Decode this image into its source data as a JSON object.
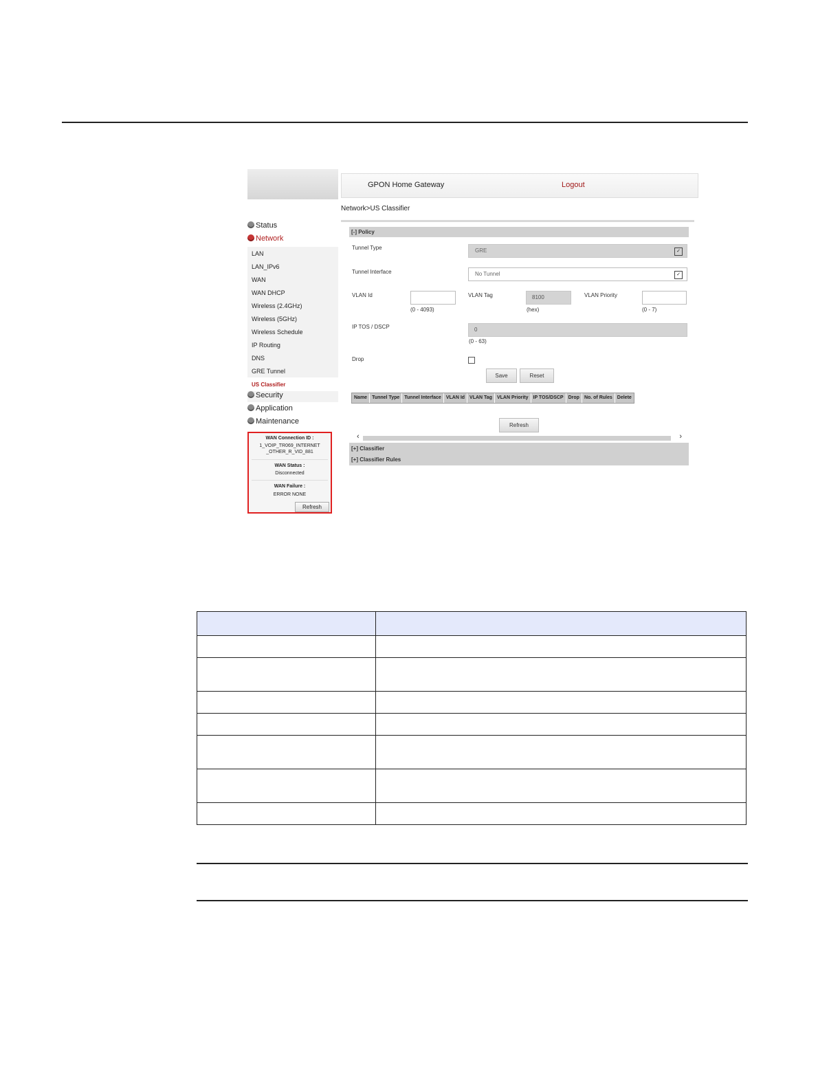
{
  "screenshot": {
    "header": {
      "title": "GPON Home Gateway",
      "logout": "Logout"
    },
    "breadcrumb": "Network>US Classifier",
    "sidebar": {
      "groups": [
        "Status",
        "Network",
        "Security",
        "Application",
        "Maintenance"
      ],
      "network_items": [
        "LAN",
        "LAN_IPv6",
        "WAN",
        "WAN DHCP",
        "Wireless (2.4GHz)",
        "Wireless (5GHz)",
        "Wireless Schedule",
        "IP Routing",
        "DNS",
        "GRE Tunnel",
        "US Classifier"
      ],
      "active_group": "Network",
      "selected_item": "US Classifier"
    },
    "wan_box": {
      "conn_label": "WAN Connection ID :",
      "conn_value": "1_VOIP_TR069_INTERNET _OTHER_R_VID_881",
      "status_label": "WAN Status :",
      "status_value": "Disconnected",
      "failure_label": "WAN Failure :",
      "failure_value": "ERROR NONE",
      "refresh": "Refresh"
    },
    "policy": {
      "section": "[-] Policy",
      "tunnel_type_label": "Tunnel Type",
      "tunnel_type_value": "GRE",
      "tunnel_interface_label": "Tunnel Interface",
      "tunnel_interface_value": "No Tunnel",
      "vlan_id_label": "VLAN Id",
      "vlan_id_value": "",
      "vlan_id_hint": "(0 - 4093)",
      "vlan_tag_label": "VLAN Tag",
      "vlan_tag_value": "8100",
      "vlan_tag_hint": "(hex)",
      "vlan_priority_label": "VLAN Priority",
      "vlan_priority_value": "",
      "vlan_priority_hint": "(0 - 7)",
      "ip_tos_label": "IP TOS / DSCP",
      "ip_tos_value": "0",
      "ip_tos_hint": "(0 - 63)",
      "drop_label": "Drop",
      "save": "Save",
      "reset": "Reset",
      "columns": [
        "Name",
        "Tunnel Type",
        "Tunnel Interface",
        "VLAN Id",
        "VLAN Tag",
        "VLAN Priority",
        "IP TOS/DSCP",
        "Drop",
        "No. of Rules",
        "Delete"
      ],
      "refresh": "Refresh"
    },
    "collapsed_sections": [
      "[+] Classifier",
      "[+] Classifier Rules"
    ]
  },
  "doc_table": {
    "rows": 7
  }
}
